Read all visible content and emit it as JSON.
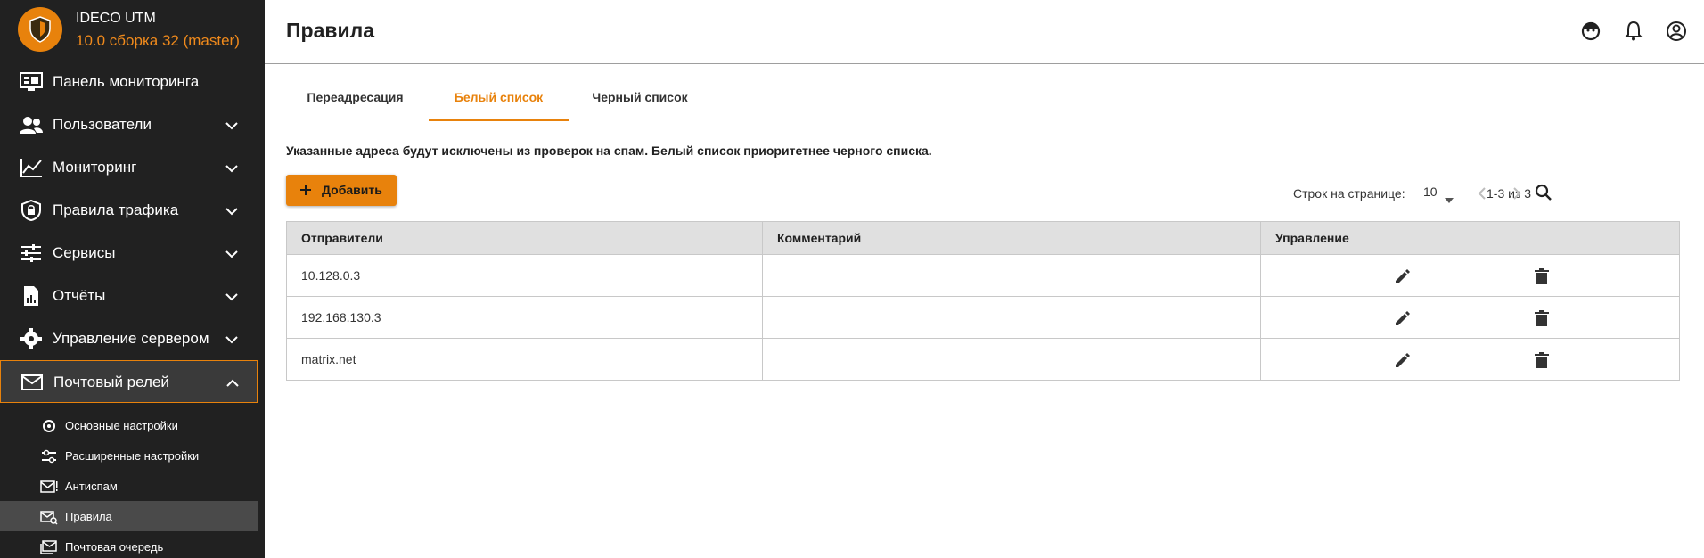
{
  "app": {
    "name": "IDECO UTM",
    "version": "10.0 сборка 32 (master)"
  },
  "sidebar": {
    "items": [
      {
        "label": "Панель мониторинга",
        "icon": "monitor-dashboard-icon"
      },
      {
        "label": "Пользователи",
        "icon": "users-icon",
        "expandable": true
      },
      {
        "label": "Мониторинг",
        "icon": "chart-line-icon",
        "expandable": true
      },
      {
        "label": "Правила трафика",
        "icon": "shield-lock-icon",
        "expandable": true
      },
      {
        "label": "Сервисы",
        "icon": "tune-icon",
        "expandable": true
      },
      {
        "label": "Отчёты",
        "icon": "report-file-icon",
        "expandable": true
      },
      {
        "label": "Управление сервером",
        "icon": "gear-icon",
        "expandable": true
      },
      {
        "label": "Почтовый релей",
        "icon": "mail-icon",
        "expandable": true,
        "expanded": true
      }
    ],
    "subitems": [
      {
        "label": "Основные настройки",
        "icon": "settings-icon"
      },
      {
        "label": "Расширенные настройки",
        "icon": "sliders-icon"
      },
      {
        "label": "Антиспам",
        "icon": "mail-alert-icon"
      },
      {
        "label": "Правила",
        "icon": "mail-search-icon",
        "active": true
      },
      {
        "label": "Почтовая очередь",
        "icon": "mail-queue-icon"
      }
    ]
  },
  "header": {
    "title": "Правила",
    "icons": [
      "support-icon",
      "bell-icon",
      "account-icon"
    ]
  },
  "tabs": [
    {
      "label": "Переадресация"
    },
    {
      "label": "Белый список",
      "active": true
    },
    {
      "label": "Черный список"
    }
  ],
  "info_text": "Указанные адреса будут исключены из проверок на спам. Белый список приоритетнее черного списка.",
  "toolbar": {
    "add_label": "Добавить",
    "rows_per_page_label": "Строк на странице:",
    "rows_per_page_value": "10",
    "range_label": "1-3 из 3"
  },
  "table": {
    "columns": [
      "Отправители",
      "Комментарий",
      "Управление"
    ],
    "rows": [
      {
        "sender": "10.128.0.3",
        "comment": ""
      },
      {
        "sender": "192.168.130.3",
        "comment": ""
      },
      {
        "sender": "matrix.net",
        "comment": ""
      }
    ]
  },
  "colors": {
    "accent": "#e8820c",
    "sidebar_bg": "#212121",
    "header_row_bg": "#e0e0e0"
  }
}
